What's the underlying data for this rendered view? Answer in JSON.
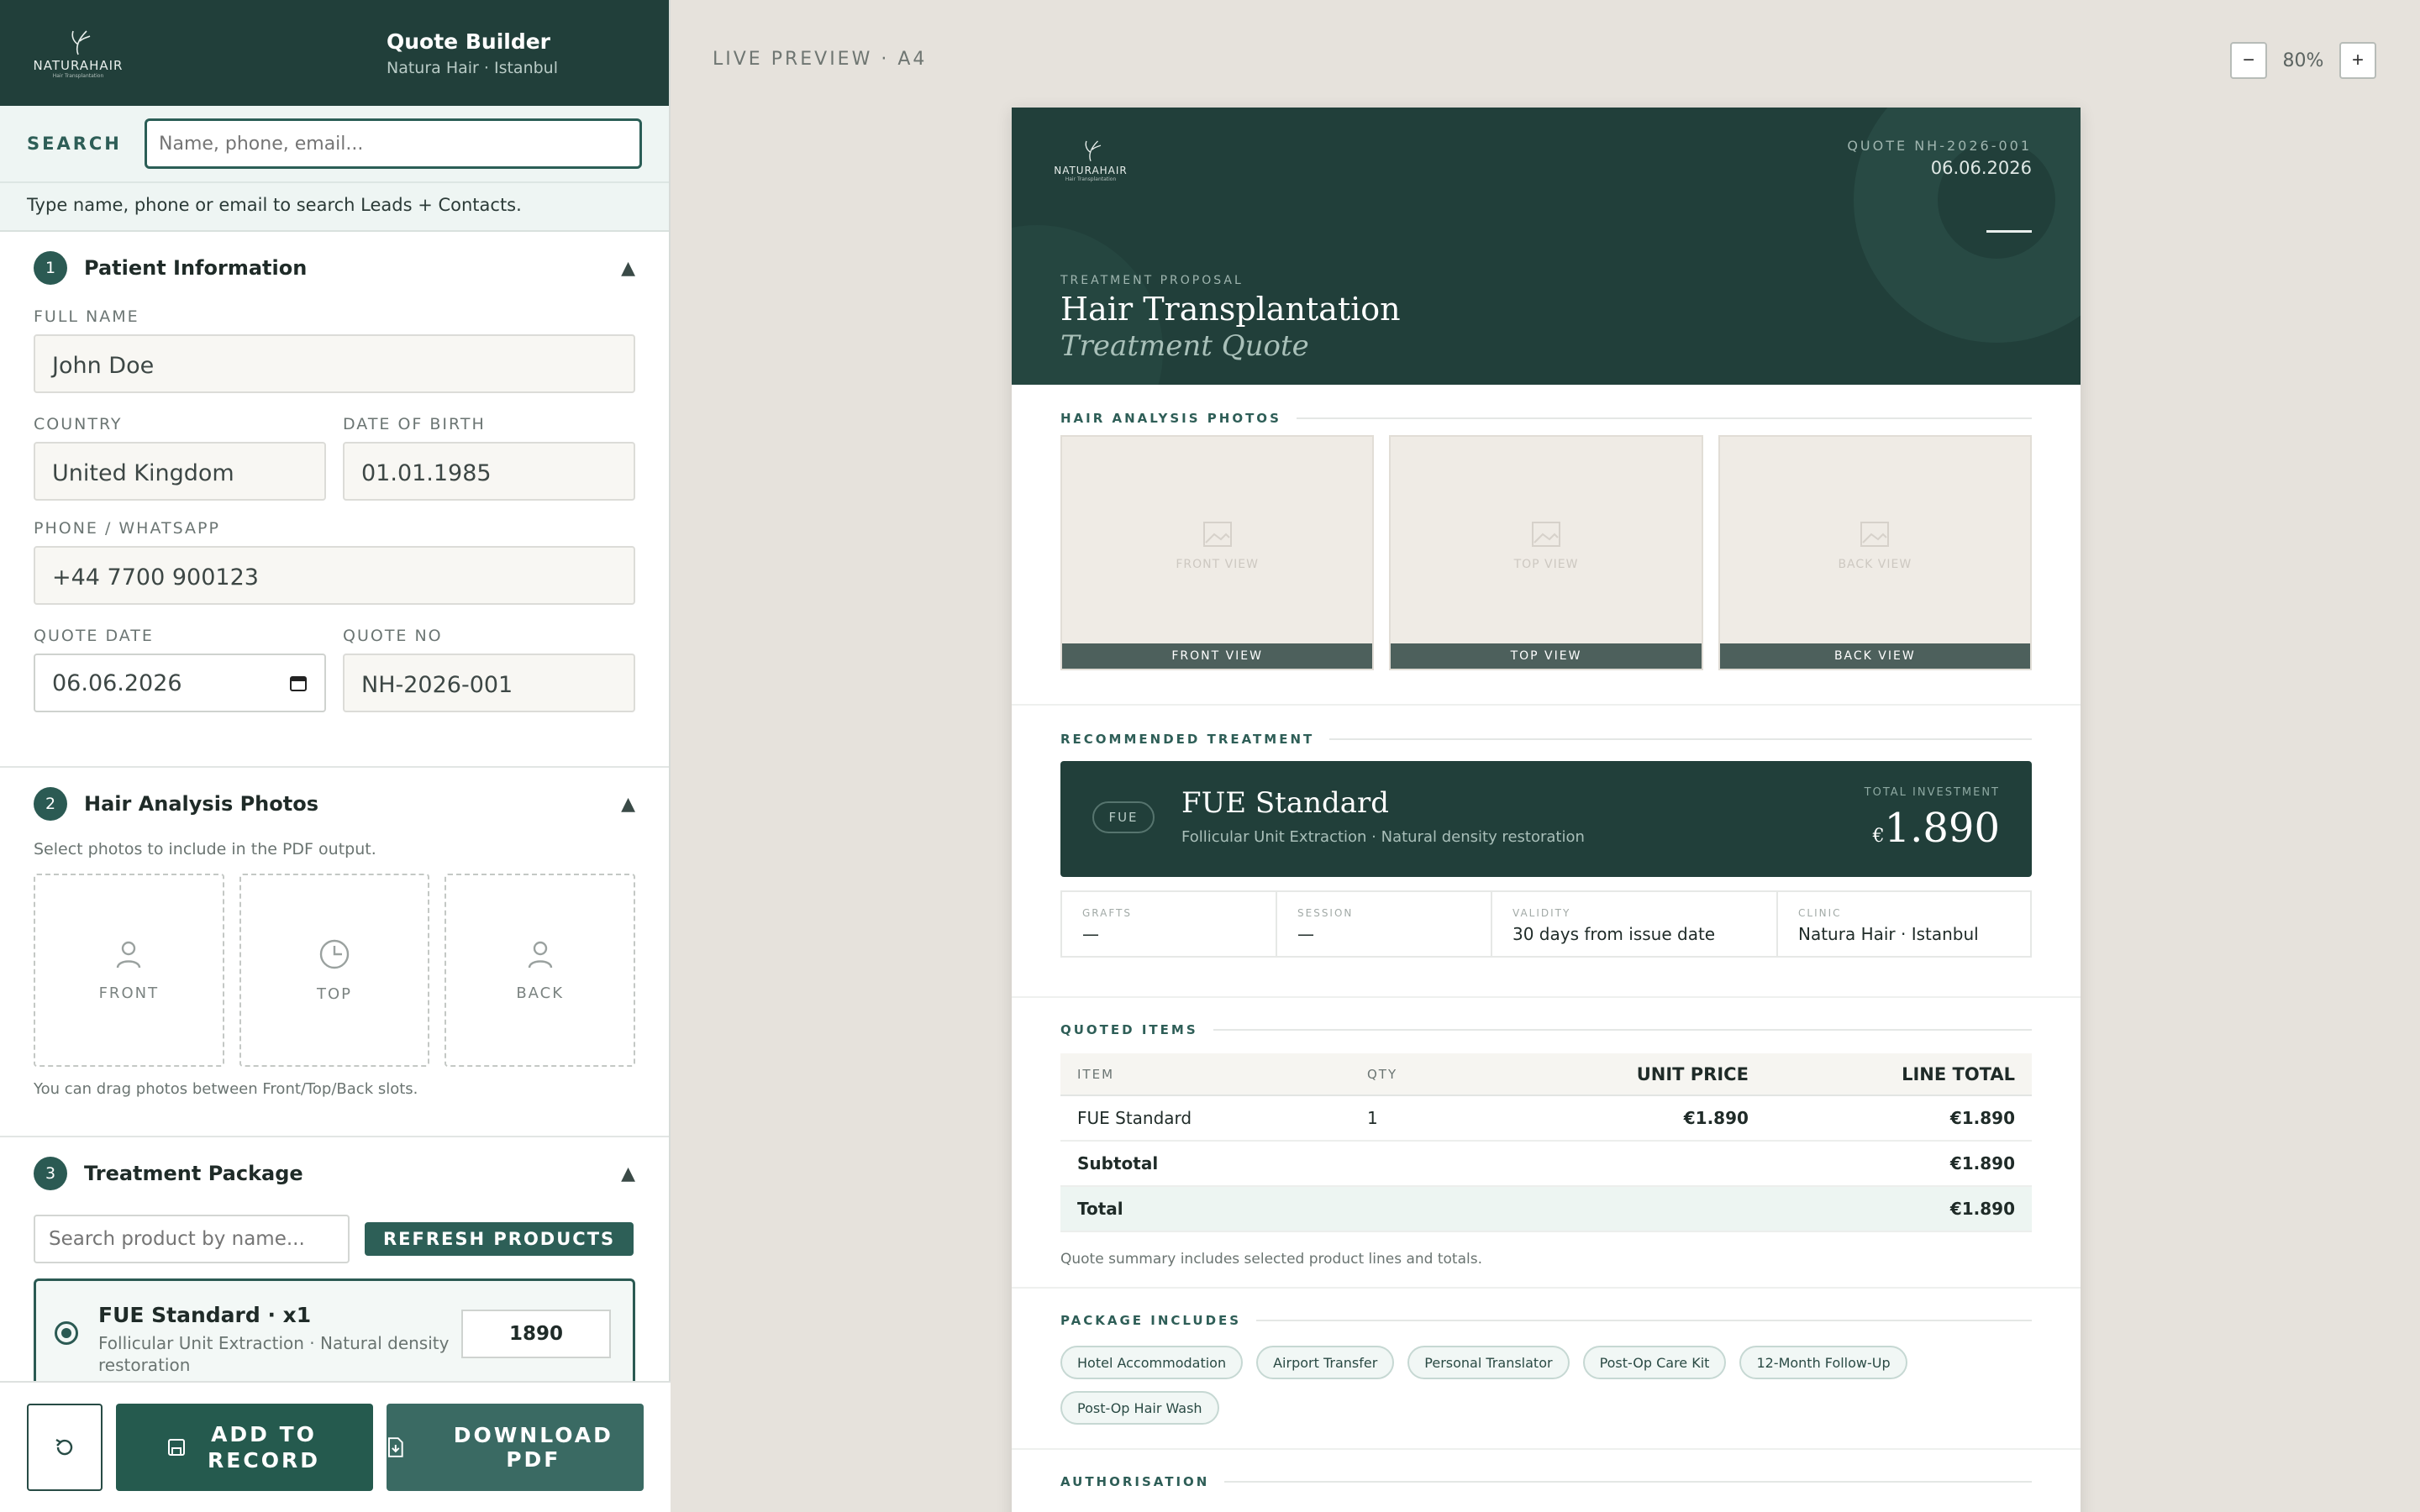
{
  "sidebar": {
    "logo_text": "NATURAHAIR",
    "logo_sub": "Hair Transplantation",
    "title": "Quote Builder",
    "subtitle": "Natura Hair · Istanbul",
    "search_label": "SEARCH",
    "search_placeholder": "Name, phone, email...",
    "search_hint": "Type name, phone or email to search Leads + Contacts.",
    "sections": [
      {
        "num": "1",
        "title": "Patient Information"
      },
      {
        "num": "2",
        "title": "Hair Analysis Photos"
      },
      {
        "num": "3",
        "title": "Treatment Package"
      }
    ],
    "patient": {
      "full_name_label": "FULL NAME",
      "full_name": "John Doe",
      "country_label": "COUNTRY",
      "country": "United Kingdom",
      "dob_label": "DATE OF BIRTH",
      "dob": "01.01.1985",
      "phone_label": "PHONE / WHATSAPP",
      "phone": "+44 7700 900123",
      "quote_date_label": "QUOTE DATE",
      "quote_date": "06.06.2026",
      "quote_no_label": "QUOTE NO",
      "quote_no": "NH-2026-001"
    },
    "photos": {
      "hint": "Select photos to include in the PDF output.",
      "slots": [
        "FRONT",
        "TOP",
        "BACK"
      ],
      "drag_hint": "You can drag photos between Front/Top/Back slots."
    },
    "package": {
      "search_placeholder": "Search product by name...",
      "refresh_label": "REFRESH PRODUCTS",
      "product_name": "FUE Standard · x1",
      "product_desc": "Follicular Unit Extraction · Natural density restoration",
      "product_price": "1890"
    },
    "actions": {
      "add_label": "ADD TO RECORD",
      "download_label": "DOWNLOAD PDF"
    }
  },
  "preview": {
    "label": "LIVE PREVIEW · A4",
    "zoom": "80%",
    "zoom_minus": "−",
    "zoom_plus": "+"
  },
  "document": {
    "quote_no": "QUOTE NH-2026-001",
    "date": "06.06.2026",
    "eyebrow": "TREATMENT PROPOSAL",
    "title": "Hair Transplantation",
    "subtitle": "Treatment Quote",
    "photos_title": "HAIR ANALYSIS PHOTOS",
    "photos": [
      {
        "placeholder": "FRONT VIEW",
        "caption": "FRONT VIEW"
      },
      {
        "placeholder": "TOP VIEW",
        "caption": "TOP VIEW"
      },
      {
        "placeholder": "BACK VIEW",
        "caption": "BACK VIEW"
      }
    ],
    "treatment_title": "RECOMMENDED TREATMENT",
    "treatment": {
      "tag": "FUE",
      "name": "FUE Standard",
      "desc": "Follicular Unit Extraction · Natural density restoration",
      "investment_label": "TOTAL INVESTMENT",
      "currency": "€",
      "amount": "1.890"
    },
    "meta": [
      {
        "label": "GRAFTS",
        "value": "—"
      },
      {
        "label": "SESSION",
        "value": "—"
      },
      {
        "label": "VALIDITY",
        "value": "30 days from issue date"
      },
      {
        "label": "CLINIC",
        "value": "Natura Hair · Istanbul"
      }
    ],
    "items_title": "QUOTED ITEMS",
    "table_headers": [
      "ITEM",
      "QTY",
      "UNIT PRICE",
      "LINE TOTAL"
    ],
    "rows": [
      {
        "item": "FUE Standard",
        "qty": "1",
        "unit": "€1.890",
        "total": "€1.890"
      }
    ],
    "subtotal_label": "Subtotal",
    "subtotal": "€1.890",
    "total_label": "Total",
    "total": "€1.890",
    "summary_note": "Quote summary includes selected product lines and totals.",
    "includes_title": "PACKAGE INCLUDES",
    "includes": [
      "Hotel Accommodation",
      "Airport Transfer",
      "Personal Translator",
      "Post-Op Care Kit",
      "12-Month Follow-Up",
      "Post-Op Hair Wash"
    ],
    "auth_title": "AUTHORISATION"
  },
  "colors": {
    "brand_dark": "#213f3a",
    "accent": "#2b5a53",
    "canvas": "#e6e2dc"
  }
}
